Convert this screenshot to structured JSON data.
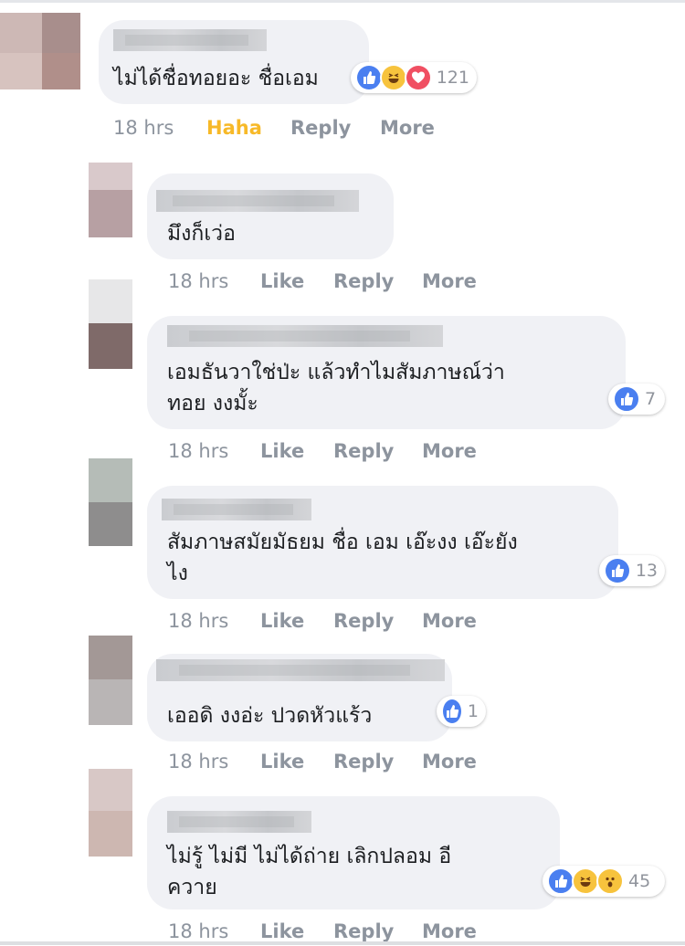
{
  "comments": [
    {
      "text_lines": [
        "ไม่ได้ชื่อทอยอะ ชื่อเอม"
      ],
      "reactions": {
        "icons": [
          "like-icon",
          "haha-icon",
          "love-icon"
        ],
        "count": "121"
      },
      "actions": {
        "time": "18 hrs",
        "react": "Haha",
        "reply": "Reply",
        "more": "More"
      }
    },
    {
      "text_lines": [
        "มึงก็เว่อ"
      ],
      "actions": {
        "time": "18 hrs",
        "react": "Like",
        "reply": "Reply",
        "more": "More"
      }
    },
    {
      "text_lines": [
        "เอมธันวาใช่ป่ะ แล้วทำไมสัมภาษณ์ว่า",
        "ทอย งงมั้ะ"
      ],
      "reactions": {
        "icons": [
          "like-icon"
        ],
        "count": "7"
      },
      "actions": {
        "time": "18 hrs",
        "react": "Like",
        "reply": "Reply",
        "more": "More"
      }
    },
    {
      "text_lines": [
        "สัมภาษสมัยมัธยม ชื่อ เอม เอ๊ะงง เอ๊ะยัง",
        "ไง"
      ],
      "reactions": {
        "icons": [
          "like-icon"
        ],
        "count": "13"
      },
      "actions": {
        "time": "18 hrs",
        "react": "Like",
        "reply": "Reply",
        "more": "More"
      }
    },
    {
      "text_lines": [
        "เออดิ งงอ่ะ ปวดหัวแร้ว"
      ],
      "reactions": {
        "icons": [
          "like-icon"
        ],
        "count": "1"
      },
      "actions": {
        "time": "18 hrs",
        "react": "Like",
        "reply": "Reply",
        "more": "More"
      }
    },
    {
      "text_lines": [
        "ไม่รู้ ไม่มี ไม่ได้ถ่าย เลิกปลอม อี",
        "ควาย"
      ],
      "reactions": {
        "icons": [
          "like-icon",
          "haha-icon",
          "wow-icon"
        ],
        "count": "45"
      },
      "actions": {
        "time": "18 hrs",
        "react": "Like",
        "reply": "Reply",
        "more": "More"
      }
    }
  ],
  "colors": {
    "active_reaction": "#f7b928",
    "like_blue": "#4a7ff0",
    "meta_gray": "#8d949e",
    "bubble_bg": "#f0f1f5"
  }
}
